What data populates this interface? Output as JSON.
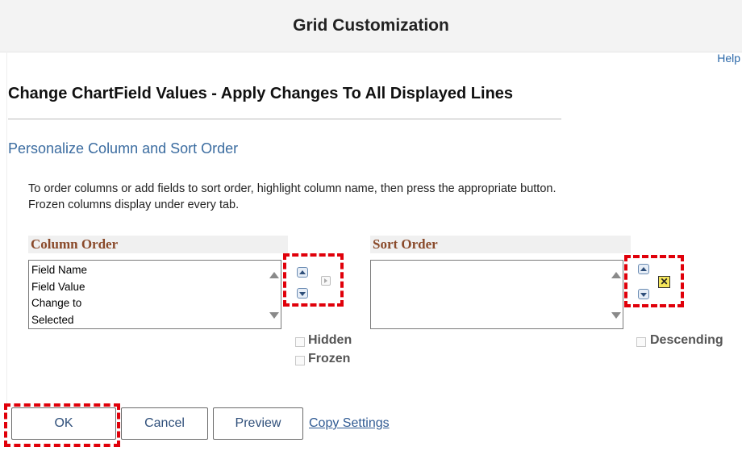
{
  "window": {
    "title": "Grid Customization"
  },
  "help_link": "Help",
  "page_heading": "Change ChartField Values - Apply Changes To All Displayed Lines",
  "section_title": "Personalize Column and Sort Order",
  "instructions": {
    "line1": "To order columns or add fields to sort order, highlight column name, then press the appropriate button.",
    "line2": "Frozen columns display under every tab."
  },
  "column_order": {
    "header": "Column Order",
    "items": [
      "Field Name",
      "Field Value",
      "Change to",
      "Selected"
    ],
    "checkboxes": [
      {
        "label": "Hidden",
        "checked": false
      },
      {
        "label": "Frozen",
        "checked": false
      }
    ]
  },
  "sort_order": {
    "header": "Sort Order",
    "items": [],
    "checkbox": {
      "label": "Descending",
      "checked": false
    }
  },
  "buttons": {
    "ok": "OK",
    "cancel": "Cancel",
    "preview": "Preview",
    "copy_settings": "Copy Settings"
  },
  "colors": {
    "highlight": "#e0000a",
    "link": "#2f5a93",
    "header_text": "#8a4a2a"
  }
}
